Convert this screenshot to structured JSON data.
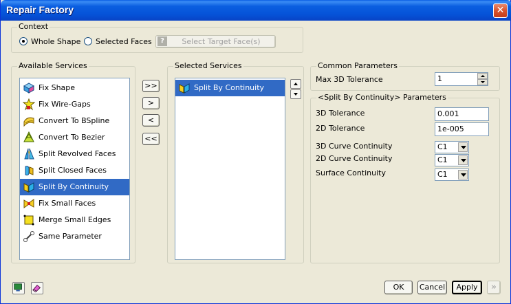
{
  "window": {
    "title": "Repair Factory",
    "close_glyph": "✕"
  },
  "context": {
    "legend": "Context",
    "whole_shape_label": "Whole Shape",
    "selected_faces_label": "Selected Faces",
    "selected_option": "Whole Shape",
    "select_target_button": "Select Target Face(s)",
    "help_glyph": "?"
  },
  "available_services": {
    "legend": "Available Services",
    "selected_item": "Split By Continuity",
    "items": [
      {
        "label": "Fix Shape",
        "icon": "fix-shape-icon"
      },
      {
        "label": "Fix Wire-Gaps",
        "icon": "fix-wire-gaps-icon"
      },
      {
        "label": "Convert To BSpline",
        "icon": "convert-bspline-icon"
      },
      {
        "label": "Convert To Bezier",
        "icon": "convert-bezier-icon"
      },
      {
        "label": "Split Revolved Faces",
        "icon": "split-revolved-icon"
      },
      {
        "label": "Split Closed Faces",
        "icon": "split-closed-icon"
      },
      {
        "label": "Split By Continuity",
        "icon": "split-continuity-icon"
      },
      {
        "label": "Fix Small Faces",
        "icon": "fix-small-faces-icon"
      },
      {
        "label": "Merge Small Edges",
        "icon": "merge-edges-icon"
      },
      {
        "label": "Same Parameter",
        "icon": "same-parameter-icon"
      }
    ]
  },
  "transfer_buttons": {
    "add_all": ">>",
    "add": ">",
    "remove": "<",
    "remove_all": "<<"
  },
  "selected_services": {
    "legend": "Selected Services",
    "items": [
      {
        "label": "Split By Continuity",
        "icon": "split-continuity-icon"
      }
    ]
  },
  "common_parameters": {
    "legend": "Common Parameters",
    "max_3d_tolerance_label": "Max 3D Tolerance",
    "max_3d_tolerance_value": "1"
  },
  "split_params": {
    "legend": "<Split By Continuity> Parameters",
    "tol3d_label": "3D Tolerance",
    "tol3d_value": "0.001",
    "tol2d_label": "2D Tolerance",
    "tol2d_value": "1e-005",
    "curve3d_label": "3D Curve Continuity",
    "curve3d_value": "C1",
    "curve2d_label": "2D Curve Continuity",
    "curve2d_value": "C1",
    "surface_label": "Surface Continuity",
    "surface_value": "C1"
  },
  "footer": {
    "ok": "OK",
    "cancel": "Cancel",
    "apply": "Apply",
    "next_glyph": "»"
  },
  "colors": {
    "selection": "#316ac5",
    "title_bar": "#0553d8",
    "dialog_bg": "#ece9d8"
  }
}
